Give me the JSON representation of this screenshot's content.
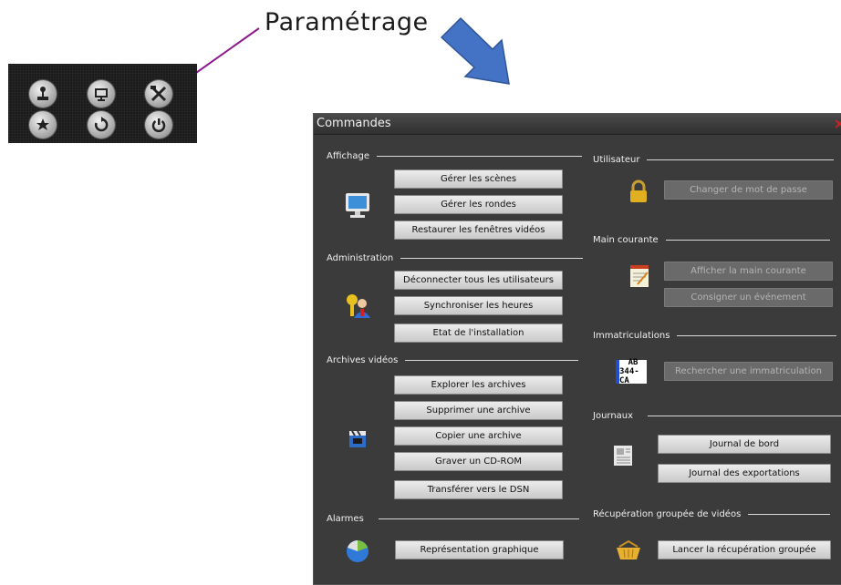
{
  "annotation": {
    "label": "Paramétrage"
  },
  "toolbar": {
    "icons": [
      "joystick-icon",
      "monitor-icon",
      "tools-icon",
      "star-icon",
      "refresh-icon",
      "power-icon"
    ]
  },
  "dialog": {
    "title": "Commandes",
    "close_glyph": "×",
    "left": {
      "affichage": {
        "title": "Affichage",
        "buttons": [
          "Gérer les scènes",
          "Gérer les rondes",
          "Restaurer les fenêtres vidéos"
        ]
      },
      "administration": {
        "title": "Administration",
        "buttons": [
          "Déconnecter tous les utilisateurs",
          "Synchroniser les heures",
          "Etat de l'installation"
        ]
      },
      "archives": {
        "title": "Archives vidéos",
        "buttons": [
          "Explorer les archives",
          "Supprimer une archive",
          "Copier une archive",
          "Graver un CD-ROM",
          "Transférer vers le DSN"
        ]
      },
      "alarmes": {
        "title": "Alarmes",
        "buttons": [
          "Représentation graphique"
        ]
      }
    },
    "right": {
      "utilisateur": {
        "title": "Utilisateur",
        "buttons": [
          "Changer de mot de passe"
        ]
      },
      "main_courante": {
        "title": "Main courante",
        "buttons": [
          "Afficher la main courante",
          "Consigner un événement"
        ]
      },
      "immatriculations": {
        "title": "Immatriculations",
        "buttons": [
          "Rechercher une immatriculation"
        ],
        "plate_line1": "AB",
        "plate_line2": "344-CA"
      },
      "journaux": {
        "title": "Journaux",
        "buttons": [
          "Journal de bord",
          "Journal des exportations"
        ]
      },
      "recuperation": {
        "title": "Récupération groupée de vidéos",
        "buttons": [
          "Lancer la récupération groupée"
        ]
      }
    }
  }
}
